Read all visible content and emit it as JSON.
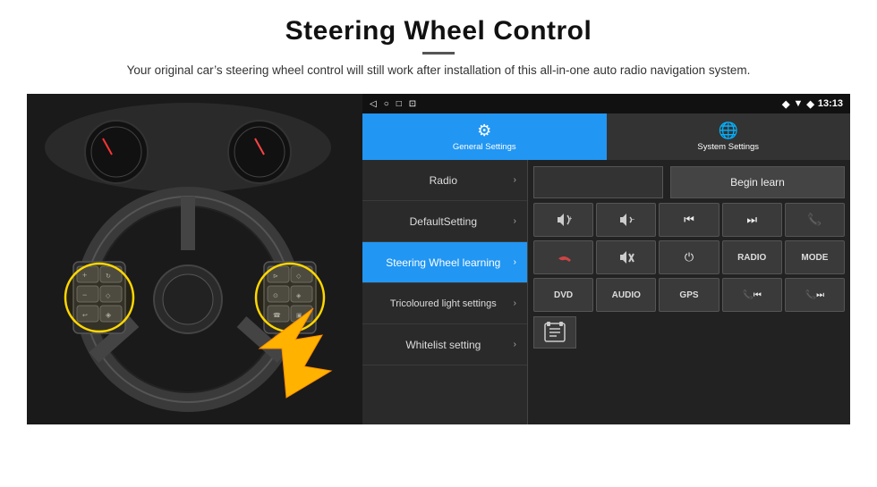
{
  "page": {
    "title": "Steering Wheel Control",
    "subtitle": "Your original car’s steering wheel control will still work after installation of this all-in-one auto radio navigation system."
  },
  "status_bar": {
    "left_icons": [
      "◁",
      "○",
      "□",
      "⊡"
    ],
    "time": "13:13",
    "signal": "▼◆"
  },
  "tabs": [
    {
      "id": "general",
      "icon": "⚙",
      "label": "General Settings",
      "active": true
    },
    {
      "id": "system",
      "icon": "🌐",
      "label": "System Settings",
      "active": false
    }
  ],
  "menu_items": [
    {
      "id": "radio",
      "label": "Radio",
      "active": false
    },
    {
      "id": "default",
      "label": "DefaultSetting",
      "active": false
    },
    {
      "id": "steering",
      "label": "Steering Wheel learning",
      "active": true
    },
    {
      "id": "tricoloured",
      "label": "Tricoloured light settings",
      "active": false
    },
    {
      "id": "whitelist",
      "label": "Whitelist setting",
      "active": false
    }
  ],
  "controls": {
    "begin_learn_label": "Begin learn",
    "row1": [
      "🔊+",
      "🔊−",
      "⏮",
      "⏭",
      "📞"
    ],
    "row2": [
      "📞↩",
      "🔊✕",
      "⏻",
      "RADIO",
      "MODE"
    ],
    "row3": [
      "DVD",
      "AUDIO",
      "GPS",
      "📞⏮",
      "📞⏭"
    ],
    "whitelist_icon": "🎛"
  }
}
